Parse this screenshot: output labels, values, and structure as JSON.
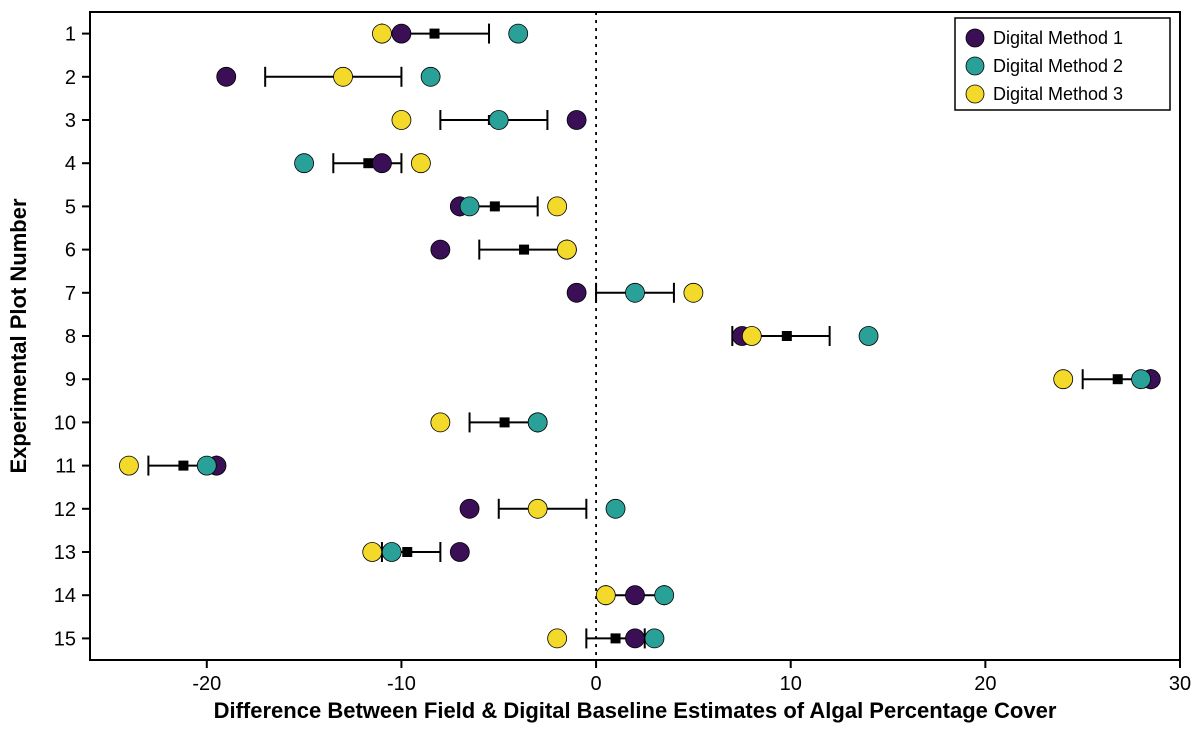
{
  "chart_data": {
    "type": "scatter",
    "title": "",
    "xlabel": "Difference Between Field & Digital Baseline Estimates of Algal Percentage Cover",
    "ylabel": "Experimental Plot Number",
    "xlim": [
      -26,
      30
    ],
    "ylim": [
      15.5,
      0.5
    ],
    "xticks": [
      -20,
      -10,
      0,
      10,
      20,
      30
    ],
    "yticks": [
      1,
      2,
      3,
      4,
      5,
      6,
      7,
      8,
      9,
      10,
      11,
      12,
      13,
      14,
      15
    ],
    "vline_at": 0,
    "colors": {
      "Digital Method 1": "#3b0f56",
      "Digital Method 2": "#2aa198",
      "Digital Method 3": "#f2d92a"
    },
    "legend": [
      "Digital Method 1",
      "Digital Method 2",
      "Digital Method 3"
    ],
    "series": [
      {
        "name": "Digital Method 1",
        "points": [
          {
            "plot": 1,
            "x": -10
          },
          {
            "plot": 2,
            "x": -19
          },
          {
            "plot": 3,
            "x": -1
          },
          {
            "plot": 4,
            "x": -11
          },
          {
            "plot": 5,
            "x": -7
          },
          {
            "plot": 6,
            "x": -8
          },
          {
            "plot": 7,
            "x": -1
          },
          {
            "plot": 8,
            "x": 7.5
          },
          {
            "plot": 9,
            "x": 28.5
          },
          {
            "plot": 10,
            "x": -3
          },
          {
            "plot": 11,
            "x": -19.5
          },
          {
            "plot": 12,
            "x": -6.5
          },
          {
            "plot": 13,
            "x": -7
          },
          {
            "plot": 14,
            "x": 2
          },
          {
            "plot": 15,
            "x": 2
          }
        ]
      },
      {
        "name": "Digital Method 2",
        "points": [
          {
            "plot": 1,
            "x": -4
          },
          {
            "plot": 2,
            "x": -8.5
          },
          {
            "plot": 3,
            "x": -5
          },
          {
            "plot": 4,
            "x": -15
          },
          {
            "plot": 5,
            "x": -6.5
          },
          {
            "plot": 6,
            "x": -1.5
          },
          {
            "plot": 7,
            "x": 2
          },
          {
            "plot": 8,
            "x": 14
          },
          {
            "plot": 9,
            "x": 28
          },
          {
            "plot": 10,
            "x": -3
          },
          {
            "plot": 11,
            "x": -20
          },
          {
            "plot": 12,
            "x": 1
          },
          {
            "plot": 13,
            "x": -10.5
          },
          {
            "plot": 14,
            "x": 3.5
          },
          {
            "plot": 15,
            "x": 3
          }
        ]
      },
      {
        "name": "Digital Method 3",
        "points": [
          {
            "plot": 1,
            "x": -11
          },
          {
            "plot": 2,
            "x": -13
          },
          {
            "plot": 3,
            "x": -10
          },
          {
            "plot": 4,
            "x": -9
          },
          {
            "plot": 5,
            "x": -2
          },
          {
            "plot": 6,
            "x": -1.5
          },
          {
            "plot": 7,
            "x": 5
          },
          {
            "plot": 8,
            "x": 8
          },
          {
            "plot": 9,
            "x": 24
          },
          {
            "plot": 10,
            "x": -8
          },
          {
            "plot": 11,
            "x": -24
          },
          {
            "plot": 12,
            "x": -3
          },
          {
            "plot": 13,
            "x": -11.5
          },
          {
            "plot": 14,
            "x": 0.5
          },
          {
            "plot": 15,
            "x": -2
          }
        ]
      }
    ],
    "mean_ci": [
      {
        "plot": 1,
        "mean": -8.3,
        "lo": -11,
        "hi": -5.5
      },
      {
        "plot": 2,
        "mean": -13,
        "lo": -17,
        "hi": -10
      },
      {
        "plot": 3,
        "mean": -5.3,
        "lo": -8,
        "hi": -2.5
      },
      {
        "plot": 4,
        "mean": -11.7,
        "lo": -13.5,
        "hi": -10
      },
      {
        "plot": 5,
        "mean": -5.2,
        "lo": -7,
        "hi": -3
      },
      {
        "plot": 6,
        "mean": -3.7,
        "lo": -6,
        "hi": -1.5
      },
      {
        "plot": 7,
        "mean": 2,
        "lo": 0,
        "hi": 4
      },
      {
        "plot": 8,
        "mean": 9.8,
        "lo": 7,
        "hi": 12
      },
      {
        "plot": 9,
        "mean": 26.8,
        "lo": 25,
        "hi": 28.5
      },
      {
        "plot": 10,
        "mean": -4.7,
        "lo": -6.5,
        "hi": -3
      },
      {
        "plot": 11,
        "mean": -21.2,
        "lo": -23,
        "hi": -19.5
      },
      {
        "plot": 12,
        "mean": -2.8,
        "lo": -5,
        "hi": -0.5
      },
      {
        "plot": 13,
        "mean": -9.7,
        "lo": -11,
        "hi": -8
      },
      {
        "plot": 14,
        "mean": 2,
        "lo": 0.5,
        "hi": 3.5
      },
      {
        "plot": 15,
        "mean": 1,
        "lo": -0.5,
        "hi": 2.5
      }
    ]
  }
}
